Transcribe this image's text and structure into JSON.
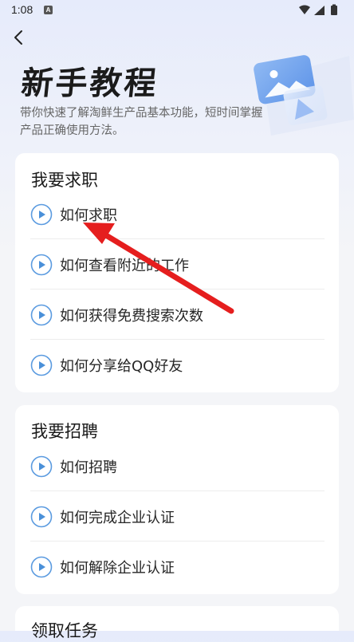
{
  "status_bar": {
    "time": "1:08",
    "notification_letter": "A"
  },
  "header": {
    "title": "新手教程",
    "subtitle": "带你快速了解淘鲜生产品基本功能，短时间掌握产品正确使用方法。"
  },
  "sections": [
    {
      "title": "我要求职",
      "items": [
        {
          "label": "如何求职"
        },
        {
          "label": "如何查看附近的工作"
        },
        {
          "label": "如何获得免费搜索次数"
        },
        {
          "label": "如何分享给QQ好友"
        }
      ]
    },
    {
      "title": "我要招聘",
      "items": [
        {
          "label": "如何招聘"
        },
        {
          "label": "如何完成企业认证"
        },
        {
          "label": "如何解除企业认证"
        }
      ]
    },
    {
      "title": "领取任务"
    }
  ],
  "colors": {
    "accent": "#4a90d9",
    "annotation": "#e51e1e",
    "card": "#ffffff",
    "background": "#f4f5f8"
  }
}
